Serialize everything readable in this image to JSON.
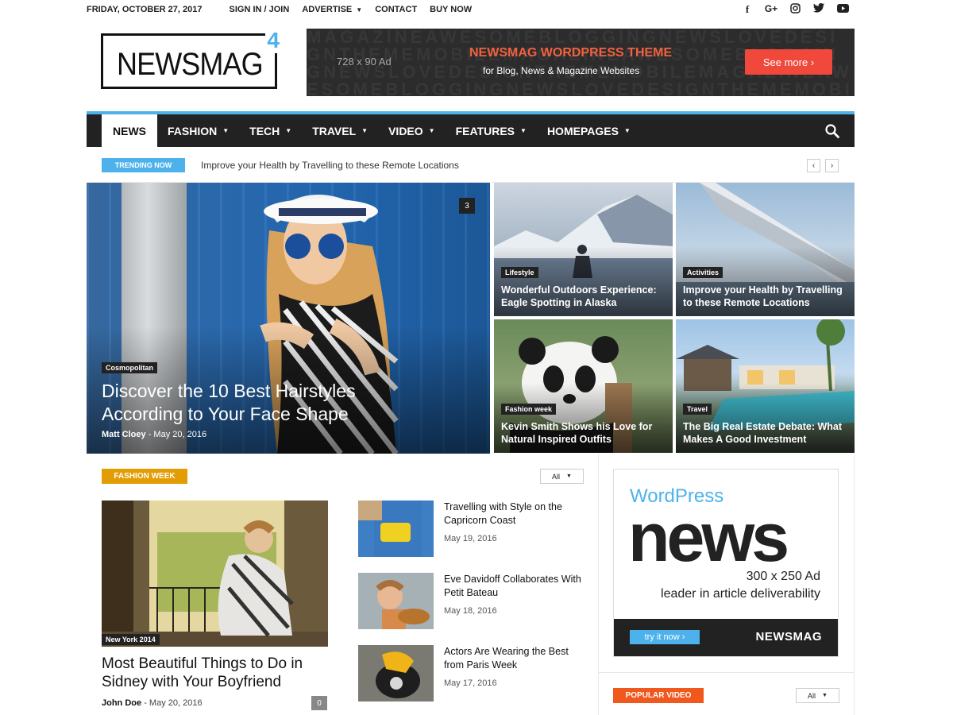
{
  "topbar": {
    "date": "FRIDAY, OCTOBER 27, 2017",
    "links": [
      {
        "label": "SIGN IN / JOIN",
        "caret": false
      },
      {
        "label": "ADVERTISE",
        "caret": true
      },
      {
        "label": "CONTACT",
        "caret": false
      },
      {
        "label": "BUY NOW",
        "caret": false
      }
    ],
    "social": [
      "facebook-icon",
      "google-plus-icon",
      "instagram-icon",
      "twitter-icon",
      "youtube-icon"
    ]
  },
  "logo": {
    "text": "NEWSMAG",
    "superscript": "4"
  },
  "top_ad": {
    "size": "728 x 90 Ad",
    "headline": "NEWSMAG WORDPRESS THEME",
    "subline": "for Blog, News & Magazine Websites",
    "button": "See more ›"
  },
  "nav": {
    "items": [
      {
        "label": "NEWS",
        "active": true
      },
      {
        "label": "FASHION",
        "caret": true
      },
      {
        "label": "TECH",
        "caret": true
      },
      {
        "label": "TRAVEL",
        "caret": true
      },
      {
        "label": "VIDEO",
        "caret": true
      },
      {
        "label": "FEATURES",
        "caret": true
      },
      {
        "label": "HOMEPAGES",
        "caret": true
      }
    ]
  },
  "trending": {
    "badge": "TRENDING NOW",
    "text": "Improve your Health by Travelling to these Remote Locations"
  },
  "featured": {
    "main": {
      "category": "Cosmopolitan",
      "title": "Discover the 10 Best Hairstyles According to Your Face Shape",
      "author": "Matt Cloey",
      "date": "May 20, 2016",
      "comments": "3"
    },
    "tiles": [
      {
        "category": "Lifestyle",
        "title": "Wonderful Outdoors Experience: Eagle Spotting in Alaska"
      },
      {
        "category": "Activities",
        "title": "Improve your Health by Travelling to these Remote Locations"
      },
      {
        "category": "Fashion week",
        "title": "Kevin Smith Shows his Love for Natural Inspired Outfits"
      },
      {
        "category": "Travel",
        "title": "The Big Real Estate Debate: What Makes A Good Investment"
      }
    ]
  },
  "fashion_week": {
    "badge": "FASHION WEEK",
    "filter": "All",
    "main": {
      "category": "New York 2014",
      "title": "Most Beautiful Things to Do in Sidney with Your Boyfriend",
      "author": "John Doe",
      "date": "May 20, 2016",
      "comments": "0"
    },
    "list": [
      {
        "title": "Travelling with Style on the Capricorn Coast",
        "date": "May 19, 2016"
      },
      {
        "title": "Eve Davidoff Collaborates With Petit Bateau",
        "date": "May 18, 2016"
      },
      {
        "title": "Actors Are Wearing the Best from Paris Week",
        "date": "May 17, 2016"
      }
    ]
  },
  "side_ad": {
    "wp": "WordPress",
    "news": "news",
    "size": "300 x 250 Ad",
    "lead": "leader in article deliverability",
    "try": "try it now ›",
    "brand": "NEWSMAG"
  },
  "popular_video": {
    "badge": "POPULAR VIDEO",
    "filter": "All"
  }
}
